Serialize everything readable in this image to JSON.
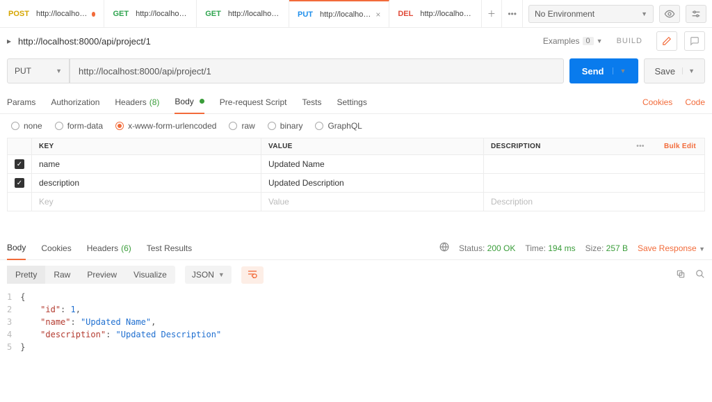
{
  "env": {
    "selected": "No Environment"
  },
  "tabs": [
    {
      "method": "POST",
      "label": "http://localhost:8…",
      "dirty": true
    },
    {
      "method": "GET",
      "label": "http://localhost:8…"
    },
    {
      "method": "GET",
      "label": "http://localhost:8…"
    },
    {
      "method": "PUT",
      "label": "http://localhost:80…",
      "close": "×",
      "active": true
    },
    {
      "method": "DEL",
      "label": "http://localhost:8…"
    }
  ],
  "request": {
    "name": "http://localhost:8000/api/project/1",
    "examples_label": "Examples",
    "examples_count": "0",
    "build_label": "BUILD",
    "method": "PUT",
    "url": "http://localhost:8000/api/project/1",
    "send_label": "Send",
    "save_label": "Save"
  },
  "req_tabs": {
    "params": "Params",
    "auth": "Authorization",
    "headers": "Headers",
    "headers_count": "(8)",
    "body": "Body",
    "prereq": "Pre-request Script",
    "tests": "Tests",
    "settings": "Settings",
    "cookies": "Cookies",
    "code": "Code"
  },
  "body_radios": {
    "none": "none",
    "formdata": "form-data",
    "xwww": "x-www-form-urlencoded",
    "raw": "raw",
    "binary": "binary",
    "graphql": "GraphQL"
  },
  "kv": {
    "head_key": "KEY",
    "head_value": "VALUE",
    "head_desc": "DESCRIPTION",
    "bulk": "Bulk Edit",
    "dots": "•••",
    "rows": [
      {
        "key": "name",
        "value": "Updated Name"
      },
      {
        "key": "description",
        "value": "Updated Description"
      }
    ],
    "ph_key": "Key",
    "ph_value": "Value",
    "ph_desc": "Description"
  },
  "response": {
    "tabs": {
      "body": "Body",
      "cookies": "Cookies",
      "headers": "Headers",
      "headers_count": "(6)",
      "tests": "Test Results"
    },
    "status_label": "Status:",
    "status_value": "200 OK",
    "time_label": "Time:",
    "time_value": "194 ms",
    "size_label": "Size:",
    "size_value": "257 B",
    "save_response": "Save Response",
    "tools": {
      "pretty": "Pretty",
      "raw": "Raw",
      "preview": "Preview",
      "visualize": "Visualize",
      "lang": "JSON"
    },
    "json": {
      "l1": "{",
      "l2_key": "\"id\"",
      "l2_val": "1",
      "l3_key": "\"name\"",
      "l3_val": "\"Updated Name\"",
      "l4_key": "\"description\"",
      "l4_val": "\"Updated Description\"",
      "l5": "}"
    }
  }
}
